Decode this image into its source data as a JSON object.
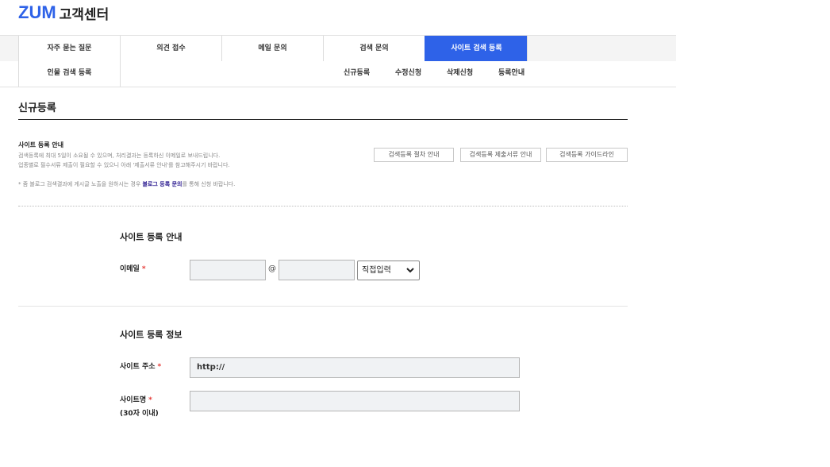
{
  "header": {
    "brand": "ZUM",
    "title": "고객센터"
  },
  "tabs": [
    {
      "label": "자주 묻는 질문",
      "active": false
    },
    {
      "label": "의견 접수",
      "active": false
    },
    {
      "label": "메일 문의",
      "active": false
    },
    {
      "label": "검색 문의",
      "active": false
    },
    {
      "label": "사이트 검색 등록",
      "active": true
    }
  ],
  "subnav": {
    "left": "인물 검색 등록",
    "items": [
      "신규등록",
      "수정신청",
      "삭제신청",
      "등록안내"
    ]
  },
  "page": {
    "title": "신규등록"
  },
  "guide": {
    "heading": "사이트 등록 안내",
    "line1": "검색등록에 최대 5일이 소요될 수 있으며, 처리결과는 등록하신 이메일로 보내드립니다.",
    "line2": "업종별로 필수서류 제출이 필요할 수 있으니 아래 '제출서류 안내'를 참고해주시기 바랍니다.",
    "note_prefix": "* 줌 블로그 검색결과에 게시글 노출을 원하시는 경우 ",
    "note_link": "블로그 등록 문의",
    "note_suffix": "를 통해 신청 바랍니다.",
    "buttons": [
      "검색등록 절차 안내",
      "검색등록 제출서류 안내",
      "검색등록 가이드라인"
    ]
  },
  "section1": {
    "title": "사이트 등록 안내",
    "email_label": "이메일",
    "at_sign": "@",
    "domain_select": "직접입력"
  },
  "section2": {
    "title": "사이트 등록 정보",
    "url_label": "사이트 주소",
    "url_value": "http://",
    "name_label": "사이트명",
    "name_hint": "(30자 이내)"
  },
  "required_mark": "*",
  "colors": {
    "accent": "#2e62e8",
    "required": "#e53935",
    "link": "#2a1a8f"
  }
}
